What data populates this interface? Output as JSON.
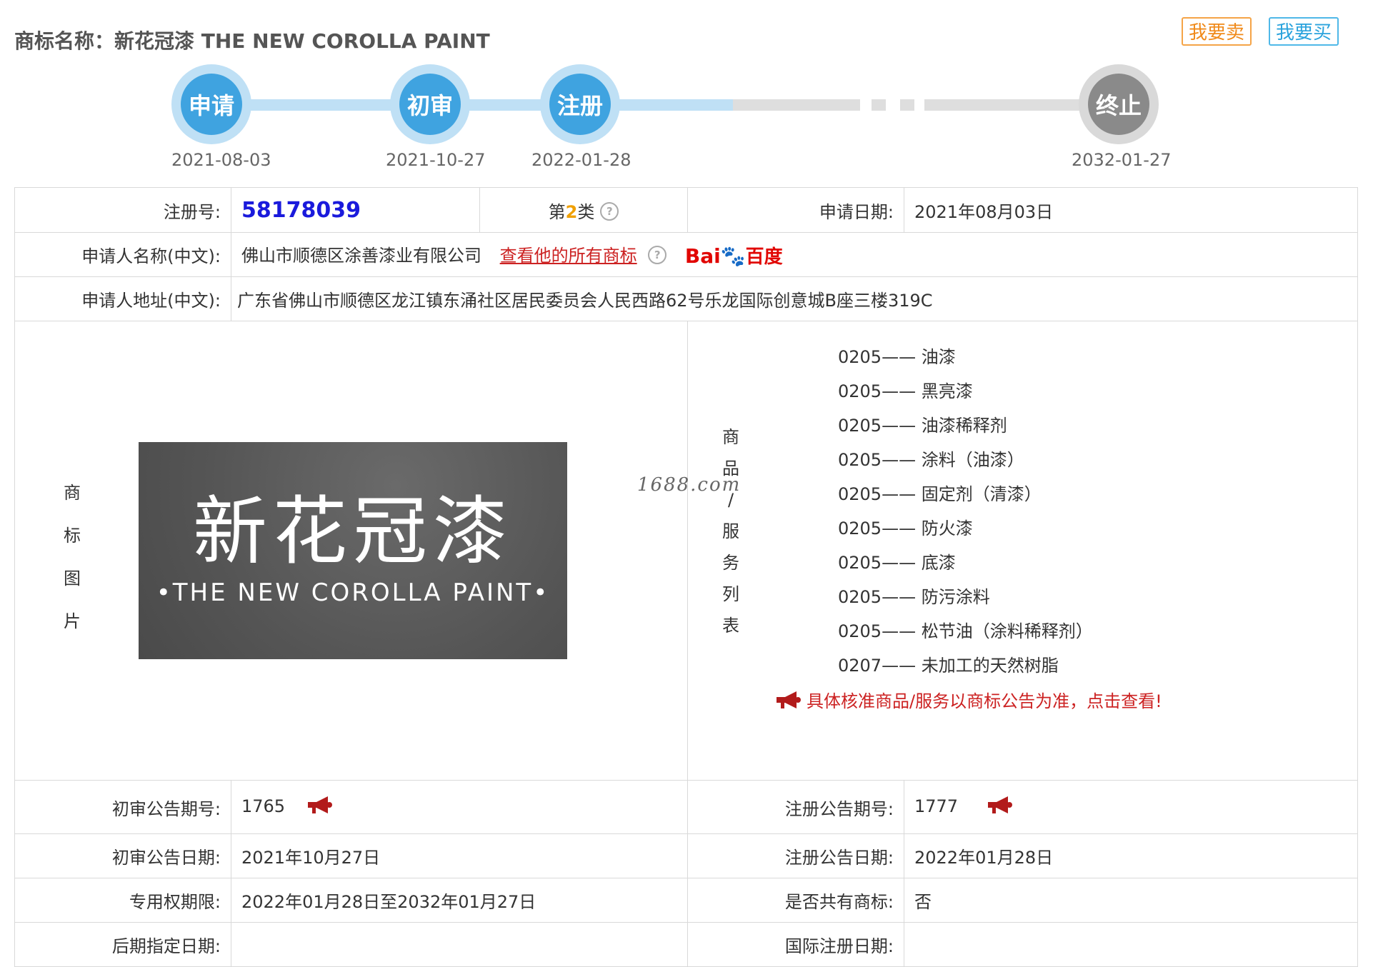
{
  "header": {
    "title": "商标名称：新花冠漆 THE NEW COROLLA PAINT",
    "sell_label": "我要卖",
    "buy_label": "我要买"
  },
  "timeline": {
    "steps": [
      {
        "label": "申请",
        "date": "2021-08-03",
        "status": "done"
      },
      {
        "label": "初审",
        "date": "2021-10-27",
        "status": "done"
      },
      {
        "label": "注册",
        "date": "2022-01-28",
        "status": "done"
      },
      {
        "label": "终止",
        "date": "2032-01-27",
        "status": "pending"
      }
    ],
    "colors": {
      "done": "#3fa3e0",
      "pending": "#8a8a8a"
    }
  },
  "info": {
    "reg_no_label": "注册号:",
    "reg_no": "58178039",
    "class_prefix": "第",
    "class_num": "2",
    "class_suffix": "类",
    "apply_date_label": "申请日期:",
    "apply_date": "2021年08月03日",
    "applicant_label": "申请人名称(中文):",
    "applicant": "佛山市顺德区涂善漆业有限公司",
    "applicant_link": "查看他的所有商标",
    "baidu_text": "百度",
    "baidu_prefix": "Bai",
    "address_label": "申请人地址(中文):",
    "address": "广东省佛山市顺德区龙江镇东涌社区居民委员会人民西路62号乐龙国际创意城B座三楼319C",
    "image_label_chars": [
      "商",
      "标",
      "图",
      "片"
    ],
    "goods_label_chars": [
      "商",
      "品",
      "/",
      "服",
      "务",
      "列",
      "表"
    ],
    "logo_cn": "新花冠漆",
    "logo_en": "•THE NEW COROLLA PAINT•",
    "watermark": "1688.com",
    "goods": [
      "0205—— 油漆",
      "0205—— 黑亮漆",
      "0205—— 油漆稀释剂",
      "0205—— 涂料（油漆）",
      "0205—— 固定剂（清漆）",
      "0205—— 防火漆",
      "0205—— 底漆",
      "0205—— 防污涂料",
      "0205—— 松节油（涂料稀释剂）",
      "0207—— 未加工的天然树脂"
    ],
    "goods_notice": "具体核准商品/服务以商标公告为准，点击查看!",
    "prelim_no_label": "初审公告期号:",
    "prelim_no": "1765",
    "reg_pub_no_label": "注册公告期号:",
    "reg_pub_no": "1777",
    "prelim_date_label": "初审公告日期:",
    "prelim_date": "2021年10月27日",
    "reg_pub_date_label": "注册公告日期:",
    "reg_pub_date": "2022年01月28日",
    "exclusive_label": "专用权期限:",
    "exclusive": "2022年01月28日至2032年01月27日",
    "shared_label": "是否共有商标:",
    "shared": "否",
    "later_label": "后期指定日期:",
    "later": "",
    "intl_label": "国际注册日期:",
    "intl": ""
  }
}
